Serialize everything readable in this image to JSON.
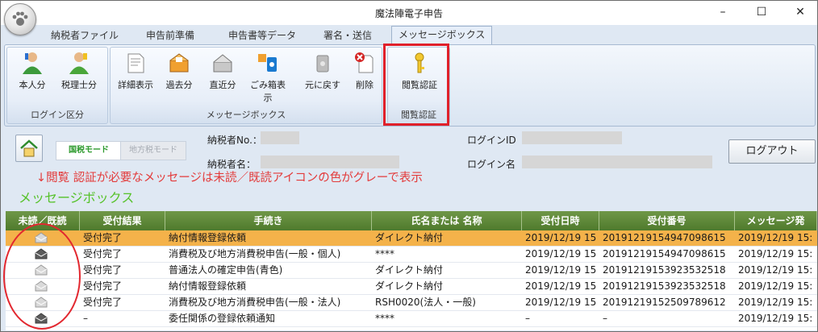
{
  "window": {
    "title": "魔法陣電子申告",
    "minimize": "–",
    "maximize": "☐",
    "close": "✕"
  },
  "tabs": [
    "納税者ファイル",
    "申告前準備",
    "申告書等データ",
    "署名・送信",
    "メッセージボックス"
  ],
  "ribbon": {
    "login_group": {
      "label": "ログイン区分",
      "buttons": [
        "本人分",
        "税理士分"
      ]
    },
    "message_group": {
      "label": "メッセージボックス",
      "buttons": [
        "詳細表示",
        "過去分",
        "直近分",
        "ごみ箱表示",
        "元に戻す",
        "削除"
      ]
    },
    "auth_group": {
      "label": "閲覧認証",
      "buttons": [
        "閲覧認証"
      ]
    }
  },
  "info": {
    "mode_national": "国税モード",
    "mode_local": "地方税モード",
    "taxpayer_no_label": "納税者No.：",
    "taxpayer_name_label": "納税者名：",
    "login_id_label": "ログインID",
    "login_name_label": "ログイン名",
    "logout_button": "ログアウト"
  },
  "annotation": {
    "note": "↓閲覧 認証が必要なメッセージは未読／既読アイコンの色がグレーで表示",
    "section_title": "メッセージボックス"
  },
  "table": {
    "columns": [
      "未読／既読",
      "受付結果",
      "手続き",
      "氏名または 名称",
      "受付日時",
      "受付番号",
      "メッセージ発"
    ],
    "rows": [
      {
        "status": "受付完了",
        "procedure": "納付情報登録依頼",
        "name": "ダイレクト納付",
        "date": "2019/12/19 15",
        "number": "20191219154947098615",
        "msg": "2019/12/19 15:",
        "icon": "gray",
        "selected": true
      },
      {
        "status": "受付完了",
        "procedure": "消費税及び地方消費税申告(一般・個人)",
        "name": "****",
        "date": "2019/12/19 15",
        "number": "20191219154947098615",
        "msg": "2019/12/19 15:",
        "icon": "dark",
        "selected": false
      },
      {
        "status": "受付完了",
        "procedure": "普通法人の確定申告(青色)",
        "name": "ダイレクト納付",
        "date": "2019/12/19 15",
        "number": "20191219153923532518",
        "msg": "2019/12/19 15:",
        "icon": "gray",
        "selected": false
      },
      {
        "status": "受付完了",
        "procedure": "納付情報登録依頼",
        "name": "ダイレクト納付",
        "date": "2019/12/19 15",
        "number": "20191219153923532518",
        "msg": "2019/12/19 15:",
        "icon": "gray",
        "selected": false
      },
      {
        "status": "受付完了",
        "procedure": "消費税及び地方消費税申告(一般・法人)",
        "name": "RSH0020(法人・一般)",
        "date": "2019/12/19 15",
        "number": "20191219152509789612",
        "msg": "2019/12/19 15:",
        "icon": "gray",
        "selected": false
      },
      {
        "status": "–",
        "procedure": "委任関係の登録依頼通知",
        "name": "****",
        "date": "–",
        "number": "–",
        "msg": "2019/12/19 15:",
        "icon": "dark",
        "selected": false
      }
    ]
  },
  "colors": {
    "highlight": "#e0202a",
    "note": "#e33b3b",
    "section": "#56c22a",
    "header": "#5a8436",
    "selected_row": "#f4b24a"
  }
}
